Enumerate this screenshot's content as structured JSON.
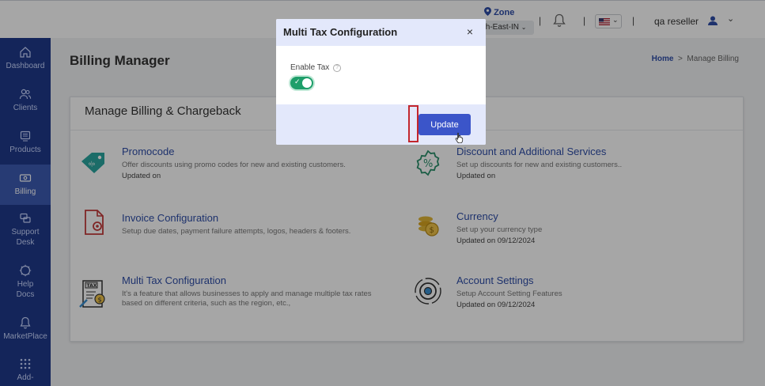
{
  "header": {
    "zone_label": "Zone",
    "zone_value": "th-East-IN",
    "separator": "|",
    "user_name": "qa reseller"
  },
  "sidebar": {
    "items": [
      {
        "label": "Dashboard",
        "icon": "home-icon"
      },
      {
        "label": "Clients",
        "icon": "users-icon"
      },
      {
        "label": "Products",
        "icon": "products-icon"
      },
      {
        "label": "Billing",
        "icon": "billing-icon"
      },
      {
        "label": "Support Desk",
        "icon": "support-icon"
      },
      {
        "label": "Help Docs",
        "icon": "help-icon"
      },
      {
        "label": "MarketPlace",
        "icon": "marketplace-icon"
      },
      {
        "label": "Add-",
        "icon": "addons-icon"
      }
    ],
    "active_color": "#3d5bb3",
    "bg_color": "#1f3a8a"
  },
  "page": {
    "title": "Billing Manager",
    "breadcrumb_home": "Home",
    "breadcrumb_sep": ">",
    "breadcrumb_current": "Manage Billing"
  },
  "card": {
    "title": "Manage Billing & Chargeback",
    "features": [
      {
        "title": "Promocode",
        "desc": "Offer discounts using promo codes for new and existing customers.",
        "updated": "Updated on",
        "icon": "promo-tag-icon"
      },
      {
        "title": "Discount and Additional Services",
        "desc": "Set up discounts for new and existing customers..",
        "updated": "Updated on",
        "icon": "discount-percent-icon"
      },
      {
        "title": "Invoice Configuration",
        "desc": "Setup due dates, payment failure attempts, logos, headers & footers.",
        "updated": "",
        "icon": "invoice-gear-icon"
      },
      {
        "title": "Currency",
        "desc": "Set up your currency type",
        "updated": "Updated on 09/12/2024",
        "icon": "coins-icon"
      },
      {
        "title": "Multi Tax Configuration",
        "desc_line1": "It's a feature that allows businesses to apply and manage multiple tax rates",
        "desc_line2": "based on different criteria, such as the region, etc.,",
        "updated": "",
        "icon": "tax-doc-icon"
      },
      {
        "title": "Account Settings",
        "desc": "Setup Account Setting Features",
        "updated": "Updated on 09/12/2024",
        "icon": "settings-gear-icon"
      }
    ]
  },
  "modal": {
    "title": "Multi Tax Configuration",
    "close": "×",
    "enable_label": "Enable Tax",
    "help": "?",
    "toggle_on": true,
    "toggle_check": "✓",
    "update_label": "Update"
  },
  "colors": {
    "accent": "#2f4ea8",
    "button": "#3b55c9",
    "toggle_on": "#1e9e6a",
    "highlight": "#c3262d"
  }
}
